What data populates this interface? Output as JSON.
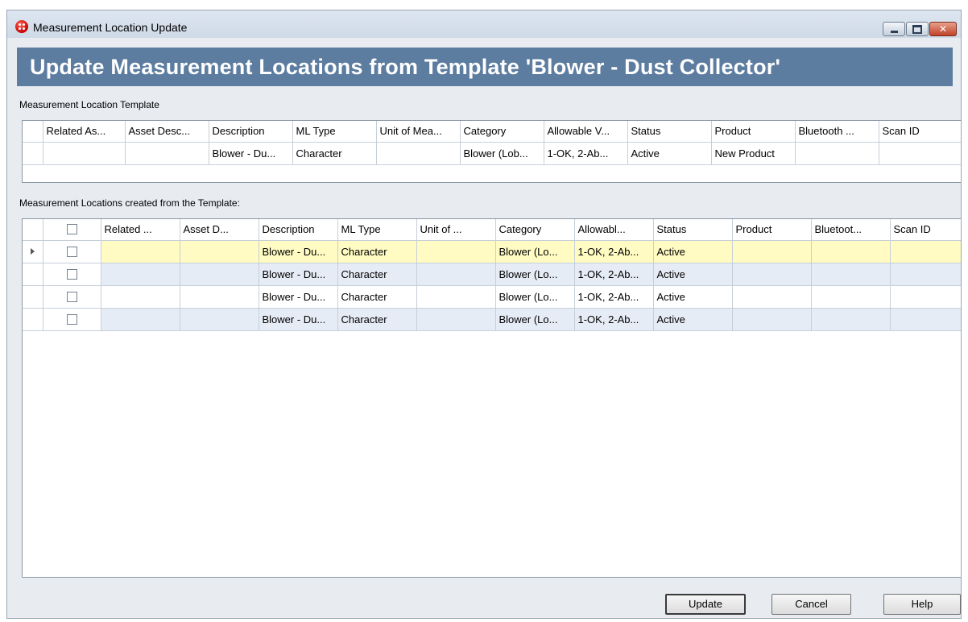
{
  "window": {
    "title": "Measurement Location Update",
    "banner": "Update Measurement Locations from Template 'Blower - Dust Collector'"
  },
  "template_section": {
    "label": "Measurement Location Template",
    "columns": [
      "Related As...",
      "Asset Desc...",
      "Description",
      "ML Type",
      "Unit of Mea...",
      "Category",
      "Allowable V...",
      "Status",
      "Product",
      "Bluetooth ...",
      "Scan ID"
    ],
    "rows": [
      [
        "",
        "",
        "Blower - Du...",
        "Character",
        "",
        "Blower (Lob...",
        "1-OK, 2-Ab...",
        "Active",
        "New Product",
        "",
        ""
      ]
    ]
  },
  "created_section": {
    "label": "Measurement Locations created from the Template:",
    "columns": [
      "Related ...",
      "Asset D...",
      "Description",
      "ML Type",
      "Unit of ...",
      "Category",
      "Allowabl...",
      "Status",
      "Product",
      "Bluetoot...",
      "Scan ID"
    ],
    "rows": [
      [
        "",
        "",
        "Blower - Du...",
        "Character",
        "",
        "Blower (Lo...",
        "1-OK, 2-Ab...",
        "Active",
        "",
        "",
        ""
      ],
      [
        "",
        "",
        "Blower - Du...",
        "Character",
        "",
        "Blower (Lo...",
        "1-OK, 2-Ab...",
        "Active",
        "",
        "",
        ""
      ],
      [
        "",
        "",
        "Blower - Du...",
        "Character",
        "",
        "Blower (Lo...",
        "1-OK, 2-Ab...",
        "Active",
        "",
        "",
        ""
      ],
      [
        "",
        "",
        "Blower - Du...",
        "Character",
        "",
        "Blower (Lo...",
        "1-OK, 2-Ab...",
        "Active",
        "",
        "",
        ""
      ]
    ]
  },
  "buttons": {
    "update": "Update",
    "cancel": "Cancel",
    "help": "Help"
  },
  "colors": {
    "banner": "#5c7ca0",
    "current_row": "#fffbc2",
    "alt_row": "#e6ecf5"
  }
}
